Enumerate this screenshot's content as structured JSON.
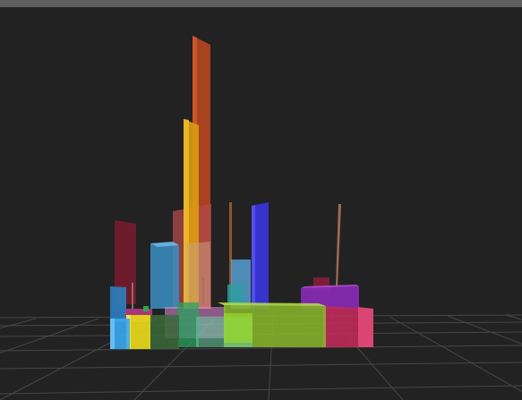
{
  "app": {
    "title_bar_color": "#5f5f5f",
    "background_color": "#222222"
  },
  "scene": {
    "type": "3d-bar-scene",
    "grid_visible": true,
    "grid_color": "#4a4a4a",
    "camera_controls": "orbit"
  }
}
